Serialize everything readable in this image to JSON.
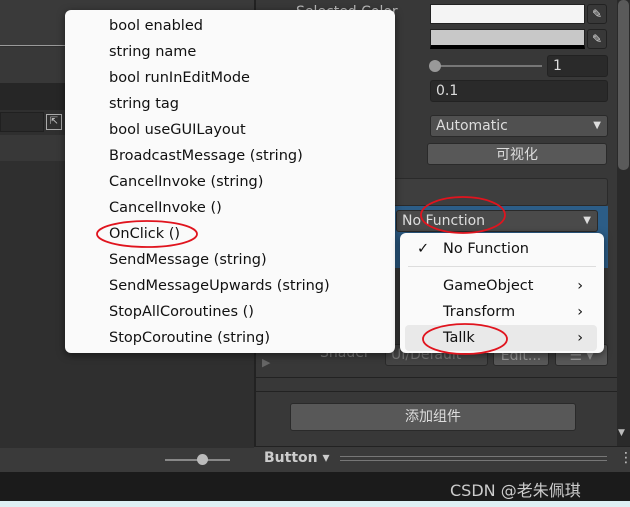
{
  "left_panel": {
    "expand_icon": "maximize-icon"
  },
  "inspector": {
    "selected_color_label": "Selected Color",
    "slider_value": "1",
    "fade_duration": "0.1",
    "navigation": "Automatic",
    "visualize_button": "可视化",
    "function_dropdown": "No Function",
    "shader_label": "Shader",
    "shader_value": "UI/Default",
    "edit_button": "Edit...",
    "add_component_button": "添加组件"
  },
  "bottom_toolbar": {
    "button_dropdown": "Button ▾"
  },
  "method_menu": {
    "items": [
      "bool enabled",
      "string name",
      "bool runInEditMode",
      "string tag",
      "bool useGUILayout",
      "BroadcastMessage (string)",
      "CancelInvoke (string)",
      "CancelInvoke ()",
      "OnClick ()",
      "SendMessage (string)",
      "SendMessageUpwards (string)",
      "StopAllCoroutines ()",
      "StopCoroutine (string)"
    ]
  },
  "function_menu": {
    "checked": "No Function",
    "items": [
      "GameObject",
      "Transform",
      "Tallk"
    ],
    "check_mark": "✓",
    "arrow": "›"
  },
  "watermark": "CSDN @老朱佩琪",
  "colors": {
    "annotation": "#e0141e",
    "selection": "#2c5d87"
  }
}
